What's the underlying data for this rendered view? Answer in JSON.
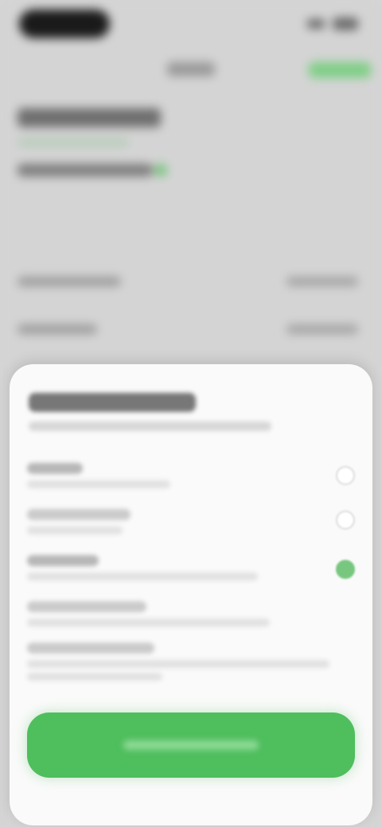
{
  "status_bar": {
    "signal_icon": "cellular-signal-icon",
    "battery_icon": "battery-icon"
  },
  "header": {
    "title": "",
    "subtitle": "",
    "primary_action": ""
  },
  "background_rows": [
    {
      "label": "",
      "value": ""
    },
    {
      "label": "",
      "value": ""
    }
  ],
  "sheet": {
    "title": "",
    "subtitle": "",
    "options": [
      {
        "label": "",
        "description": "",
        "selected": false
      },
      {
        "label": "",
        "description": "",
        "selected": false
      },
      {
        "label": "",
        "description": "",
        "selected": true
      },
      {
        "label": "",
        "description": "",
        "selected": false
      },
      {
        "label": "",
        "description": "",
        "selected": false
      }
    ],
    "cta_label": ""
  },
  "colors": {
    "accent": "#4fbe5d",
    "background": "#d4d4d4",
    "sheet": "#fafafa"
  }
}
